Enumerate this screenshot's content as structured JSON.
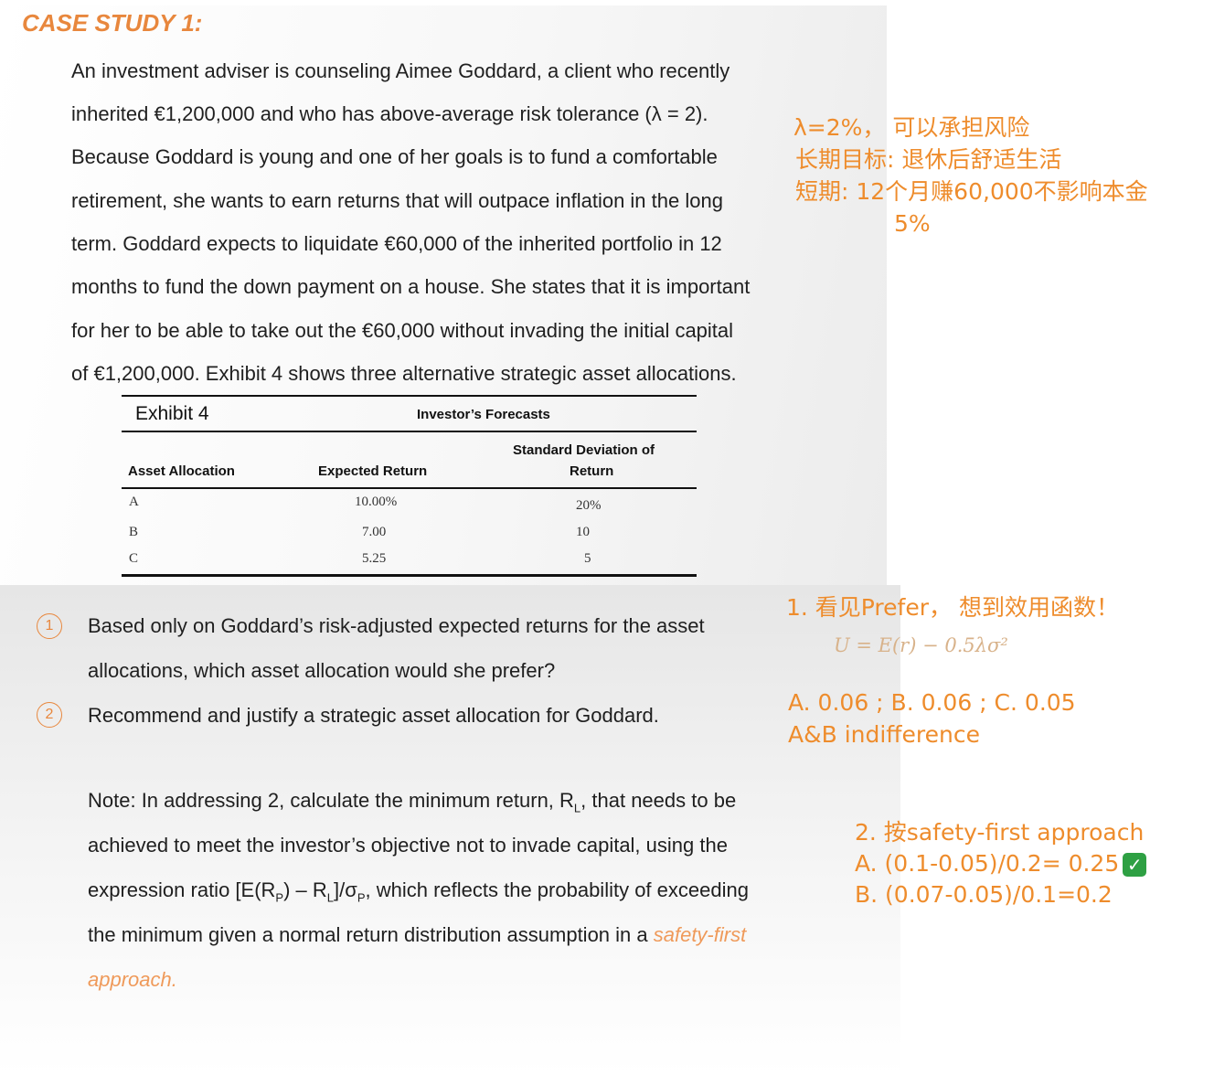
{
  "title": "CASE STUDY 1:",
  "paragraph_lines": [
    "An investment adviser is counseling Aimee Goddard, a client who recently",
    "inherited €1,200,000 and who has above-average risk tolerance (λ = 2).",
    "Because Goddard is young and one of her goals is to fund a comfortable",
    "retirement, she wants to earn returns that will outpace inflation in the long",
    "term. Goddard expects to liquidate €60,000 of the inherited portfolio in 12",
    "months to fund the down payment on a house. She states that it is important",
    "for her to be able to take out the €60,000 without invading the initial capital",
    "of €1,200,000. Exhibit 4 shows three alternative strategic asset allocations."
  ],
  "exhibit": {
    "title": "Exhibit 4",
    "subtitle": "Investor’s Forecasts",
    "headers": {
      "asset": "Asset Allocation",
      "expected": "Expected Return",
      "std_line1": "Standard Deviation of",
      "std_line2": "Return"
    },
    "rows": [
      {
        "asset": "A",
        "expected": "10.00%",
        "std": "20%"
      },
      {
        "asset": "B",
        "expected": "7.00",
        "std": "10"
      },
      {
        "asset": "C",
        "expected": "5.25",
        "std": "5"
      }
    ]
  },
  "questions": [
    {
      "number": "1",
      "lines": [
        "Based only on Goddard’s risk-adjusted expected returns for the asset",
        "allocations, which asset allocation would she prefer?"
      ]
    },
    {
      "number": "2",
      "lines": [
        "Recommend and justify a strategic asset allocation for Goddard."
      ]
    }
  ],
  "note": {
    "line1_a": "Note: In addressing 2, calculate the minimum return, R",
    "line1_sub": "L",
    "line1_b": ", that needs to be",
    "line2": "achieved to meet the investor’s objective not to invade capital, using the",
    "line3_a": "expression ratio [E(R",
    "line3_sub1": "P",
    "line3_b": ") – R",
    "line3_sub2": "L",
    "line3_c": "]/σ",
    "line3_sub3": "P",
    "line3_d": ", which reflects the probability of exceeding",
    "line4_a": "the minimum given a normal return distribution assumption in a ",
    "line4_b": "safety-first",
    "line5": "approach."
  },
  "annotations": {
    "right_top": [
      "λ=2%， 可以承担风险",
      "长期目标: 退休后舒适生活",
      "短期: 12个月赚60,000不影响本金",
      "5%"
    ],
    "prefer": "1. 看见Prefer， 想到效用函数！",
    "formula": "U = E(r) − 0.5λσ²",
    "utilities": "A. 0.06 ; B. 0.06 ; C. 0.05",
    "indifference": "A&B indifference",
    "sf_title": "2. 按safety-first approach",
    "sf_a": "A. (0.1-0.05)/0.2= 0.25",
    "sf_b": "B. (0.07-0.05)/0.1=0.2",
    "check": "✓"
  },
  "colors": {
    "accent": "#e8873d",
    "handwriting": "#ee8c2c",
    "check": "#2ea043"
  }
}
